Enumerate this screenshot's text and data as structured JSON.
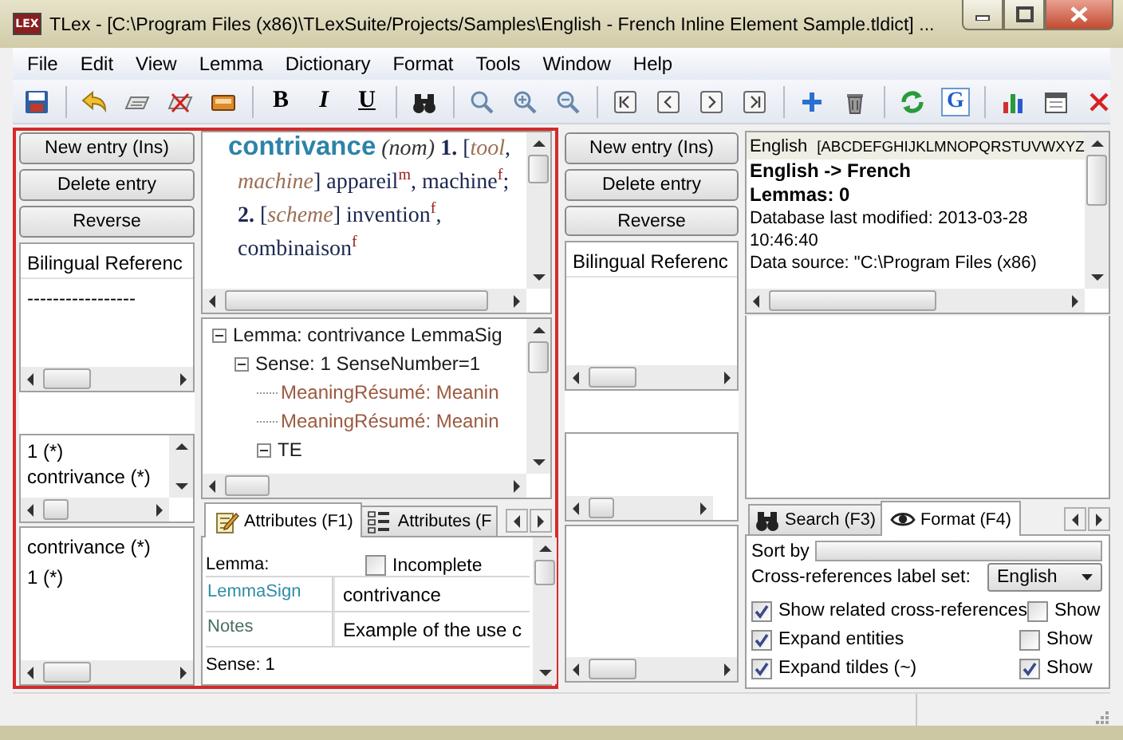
{
  "window": {
    "app_icon": "LEX",
    "title": "TLex - [C:\\Program Files (x86)\\TLexSuite/Projects/Samples\\English - French Inline Element Sample.tldict] ..."
  },
  "menu": [
    "File",
    "Edit",
    "View",
    "Lemma",
    "Dictionary",
    "Format",
    "Tools",
    "Window",
    "Help"
  ],
  "toolbar": {
    "format_buttons": [
      "B",
      "I",
      "U"
    ],
    "lookup_button": "G"
  },
  "source_column": {
    "buttons": [
      "New entry (Ins)",
      "Delete entry",
      "Reverse"
    ],
    "reference_list": {
      "header": "Bilingual Referenc",
      "rows": [
        "-----------------"
      ]
    },
    "sense_list": [
      {
        "label": "1 (*)",
        "selected": false
      },
      {
        "label": "contrivance (*)",
        "selected": false
      }
    ],
    "history_list": [
      "contrivance (*)",
      "1 (*)"
    ]
  },
  "preview": {
    "article": "**contrivance** *(nom)* **1.** [*tool*, *machine*] appareil$^{m}$, machine$^{f}$; **2.** [*scheme*] invention$^{f}$, combinaison$^{f}$"
  },
  "tree": [
    {
      "label": "Lemma: contrivance  LemmaSig",
      "kind": "element",
      "expanded": true,
      "children": [
        {
          "label": "Sense: 1  SenseNumber=1",
          "kind": "element",
          "expanded": true,
          "children": [
            {
              "label": "MeaningRésumé:  Meanin",
              "kind": "attribute"
            },
            {
              "label": "MeaningRésumé:  Meanin",
              "kind": "attribute"
            },
            {
              "label": "TE",
              "kind": "element",
              "expanded": true
            }
          ]
        }
      ]
    }
  ],
  "attribute_tabs": [
    {
      "label": "Attributes (F1)",
      "selected": true
    },
    {
      "label": "Attributes (F",
      "selected": false
    }
  ],
  "attributes": {
    "section": "Lemma:",
    "incomplete": {
      "label": "Incomplete",
      "checked": false
    },
    "fields": [
      {
        "name": "LemmaSign",
        "value": "contrivance"
      },
      {
        "name": "Notes",
        "value": "Example of the use c"
      }
    ],
    "next_section": "Sense: 1"
  },
  "target_column": {
    "buttons": [
      "New entry (Ins)",
      "Delete entry",
      "Reverse"
    ],
    "reference_list": {
      "header": "Bilingual Referenc"
    }
  },
  "info": {
    "language": "English",
    "alphabet": "[ABCDEFGHIJKLMNOPQRSTUVWXYZ",
    "direction": "English -> French",
    "lemmas": "Lemmas: 0",
    "modified": "Database last modified: 2013-03-28 10:46:40",
    "source": "Data source: \"C:\\Program Files (x86)"
  },
  "side_tabs": [
    {
      "label": "Search (F3)",
      "selected": false
    },
    {
      "label": "Format (F4)",
      "selected": true
    }
  ],
  "format": {
    "sort_label": "Sort by",
    "crossref_label": "Cross-references label set:",
    "crossref_value": "English",
    "options": [
      {
        "label": "Show related cross-references",
        "checked": true,
        "extra": {
          "label": "Show",
          "checked": false
        }
      },
      {
        "label": "Expand entities",
        "checked": true,
        "extra": {
          "label": "Show",
          "checked": false
        }
      },
      {
        "label": "Expand tildes (~)",
        "checked": true,
        "extra": {
          "label": "Show",
          "checked": true
        }
      }
    ]
  }
}
